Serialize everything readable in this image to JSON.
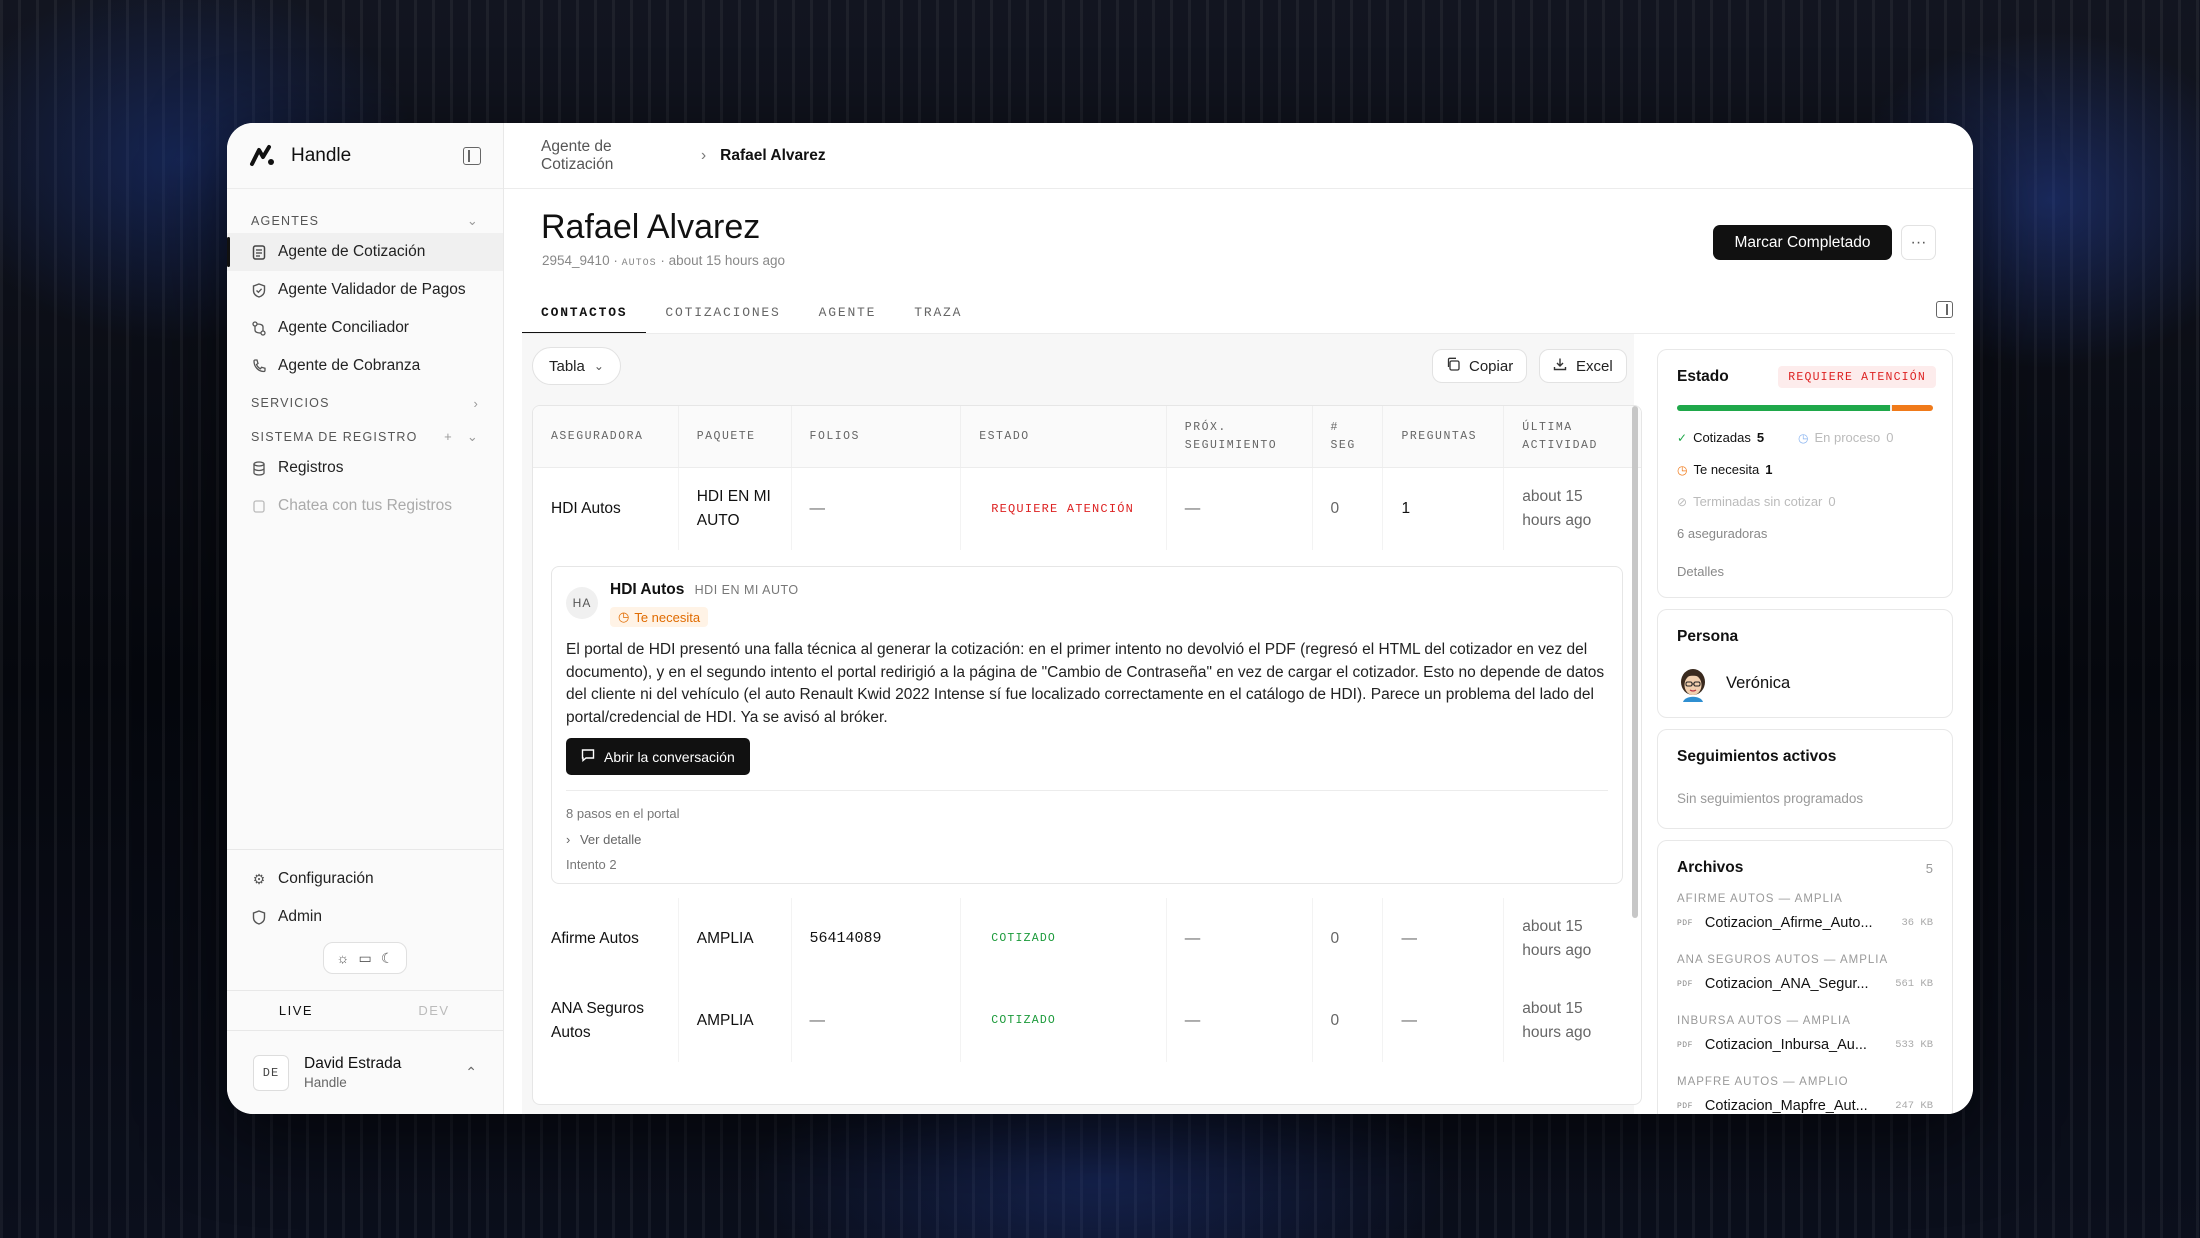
{
  "app": {
    "name": "Handle"
  },
  "sidebar": {
    "sections": {
      "agentes": "AGENTES",
      "servicios": "SERVICIOS",
      "sistema": "SISTEMA DE REGISTRO"
    },
    "items": [
      {
        "label": "Agente de Cotización"
      },
      {
        "label": "Agente Validador de Pagos"
      },
      {
        "label": "Agente Conciliador"
      },
      {
        "label": "Agente de Cobranza"
      },
      {
        "label": "Registros"
      },
      {
        "label": "Chatea con tus Registros"
      }
    ],
    "bottom": [
      {
        "label": "Configuración"
      },
      {
        "label": "Admin"
      }
    ],
    "env": {
      "live": "LIVE",
      "dev": "DEV"
    },
    "user": {
      "initials": "DE",
      "name": "David Estrada",
      "org": "Handle"
    }
  },
  "breadcrumb": {
    "parent": "Agente de Cotización",
    "current": "Rafael Alvarez"
  },
  "header": {
    "title": "Rafael Alvarez",
    "id": "2954_9410",
    "tag": "AUTOS",
    "time": "about 15 hours ago",
    "complete_btn": "Marcar Completado",
    "more": "···"
  },
  "tabs": [
    "CONTACTOS",
    "COTIZACIONES",
    "AGENTE",
    "TRAZA"
  ],
  "toolbar": {
    "view": "Tabla",
    "copy": "Copiar",
    "excel": "Excel"
  },
  "table": {
    "headers": [
      "ASEGURADORA",
      "PAQUETE",
      "FOLIOS",
      "ESTADO",
      "PRÓX. SEGUIMIENTO",
      "# SEG",
      "PREGUNTAS",
      "ÚLTIMA ACTIVIDAD"
    ],
    "rows": [
      {
        "aseguradora": "HDI Autos",
        "paquete": "HDI EN MI AUTO",
        "folios": "—",
        "estado": "REQUIERE ATENCIÓN",
        "prox": "—",
        "seg": "0",
        "preguntas": "1",
        "actividad": "about 15 hours ago"
      },
      {
        "aseguradora": "Afirme Autos",
        "paquete": "AMPLIA",
        "folios": "56414089",
        "estado": "COTIZADO",
        "prox": "—",
        "seg": "0",
        "preguntas": "—",
        "actividad": "about 15 hours ago"
      },
      {
        "aseguradora": "ANA Seguros Autos",
        "paquete": "AMPLIA",
        "folios": "—",
        "estado": "COTIZADO",
        "prox": "—",
        "seg": "0",
        "preguntas": "—",
        "actividad": "about 15 hours ago"
      }
    ]
  },
  "detail": {
    "initials": "HA",
    "name": "HDI Autos",
    "package": "HDI EN MI AUTO",
    "badge": "Te necesita",
    "body": "El portal de HDI presentó una falla técnica al generar la cotización: en el primer intento no devolvió el PDF (regresó el HTML del cotizador en vez del documento), y en el segundo intento el portal redirigió a la página de \"Cambio de Contraseña\" en vez de cargar el cotizador. Esto no depende de datos del cliente ni del vehículo (el auto Renault Kwid 2022 Intense sí fue localizado correctamente en el catálogo de HDI). Parece un problema del lado del portal/credencial de HDI. Ya se avisó al bróker.",
    "open_btn": "Abrir la conversación",
    "steps": "8 pasos en el portal",
    "ver": "Ver detalle",
    "intento": "Intento 2"
  },
  "estado": {
    "title": "Estado",
    "tag": "REQUIERE ATENCIÓN",
    "progress": {
      "cotizadas": 5,
      "necesita": 1,
      "total": 6
    },
    "cotizadas_label": "Cotizadas",
    "cotizadas_val": "5",
    "proceso_label": "En proceso",
    "proceso_val": "0",
    "necesita_label": "Te necesita",
    "necesita_val": "1",
    "terminadas_label": "Terminadas sin cotizar",
    "terminadas_val": "0",
    "aseguradoras": "6 aseguradoras",
    "detalles": "Detalles"
  },
  "persona": {
    "title": "Persona",
    "name": "Verónica"
  },
  "seguimientos": {
    "title": "Seguimientos activos",
    "empty": "Sin seguimientos programados"
  },
  "archivos": {
    "title": "Archivos",
    "count": "5",
    "groups": [
      {
        "group": "AFIRME AUTOS — AMPLIA",
        "file": "Cotizacion_Afirme_Auto...",
        "size": "36 KB"
      },
      {
        "group": "ANA SEGUROS AUTOS — AMPLIA",
        "file": "Cotizacion_ANA_Segur...",
        "size": "561 KB"
      },
      {
        "group": "INBURSA AUTOS — AMPLIA",
        "file": "Cotizacion_Inbursa_Au...",
        "size": "533 KB"
      },
      {
        "group": "MAPFRE AUTOS — AMPLIO",
        "file": "Cotizacion_Mapfre_Aut...",
        "size": "247 KB"
      }
    ],
    "pdf": "PDF"
  },
  "colors": {
    "accent": "#111111",
    "danger": "#dd2222",
    "success": "#1b9a3a",
    "warning": "#f07a1a"
  }
}
